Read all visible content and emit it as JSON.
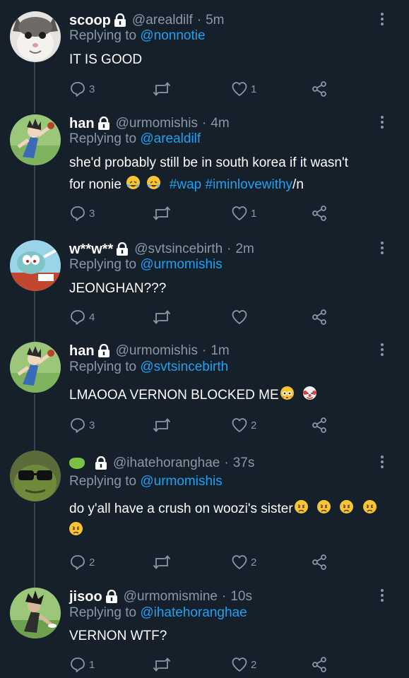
{
  "tweets": [
    {
      "name": "scoop",
      "handle": "@arealdilf",
      "time": "5m",
      "reply_prefix": "Replying to",
      "reply_to": "@nonnotie",
      "text": "IT IS GOOD",
      "replies": "3",
      "retweets": "",
      "likes": "1"
    },
    {
      "name": "han",
      "handle": "@urmomishis",
      "time": "4m",
      "reply_prefix": "Replying to",
      "reply_to": "@arealdilf",
      "text_line1": "she'd probably still be in south korea if it wasn't",
      "text_line2_pre": "for nonie",
      "hashtags": "#wap #iminlovewithy",
      "text_suffix": "/n",
      "replies": "3",
      "retweets": "",
      "likes": "1"
    },
    {
      "name": "w**w**",
      "handle": "@svtsincebirth",
      "time": "2m",
      "reply_prefix": "Replying to",
      "reply_to": "@urmomishis",
      "text": "JEONGHAN???",
      "replies": "4",
      "retweets": "",
      "likes": ""
    },
    {
      "name": "han",
      "handle": "@urmomishis",
      "time": "1m",
      "reply_prefix": "Replying to",
      "reply_to": "@svtsincebirth",
      "text": "LMAOOA VERNON BLOCKED ME",
      "replies": "3",
      "retweets": "",
      "likes": "2"
    },
    {
      "name": "",
      "handle": "@ihatehoranghae",
      "time": "37s",
      "reply_prefix": "Replying to",
      "reply_to": "@urmomishis",
      "text": "do y'all have a crush on woozi's sister",
      "replies": "2",
      "retweets": "",
      "likes": "2"
    },
    {
      "name": "jisoo",
      "handle": "@urmomismine",
      "time": "10s",
      "reply_prefix": "Replying to",
      "reply_to": "@ihatehoranghae",
      "text": "VERNON WTF?",
      "replies": "1",
      "retweets": "",
      "likes": "2"
    }
  ],
  "icons": {
    "reply": "reply-icon",
    "retweet": "retweet-icon",
    "like": "heart-icon",
    "share": "share-icon",
    "more": "more-vertical-icon",
    "lock": "lock-icon"
  },
  "colors": {
    "background": "#15202b",
    "link": "#1da1f2",
    "secondary_text": "#8899a6",
    "thread_line": "#38444d"
  }
}
